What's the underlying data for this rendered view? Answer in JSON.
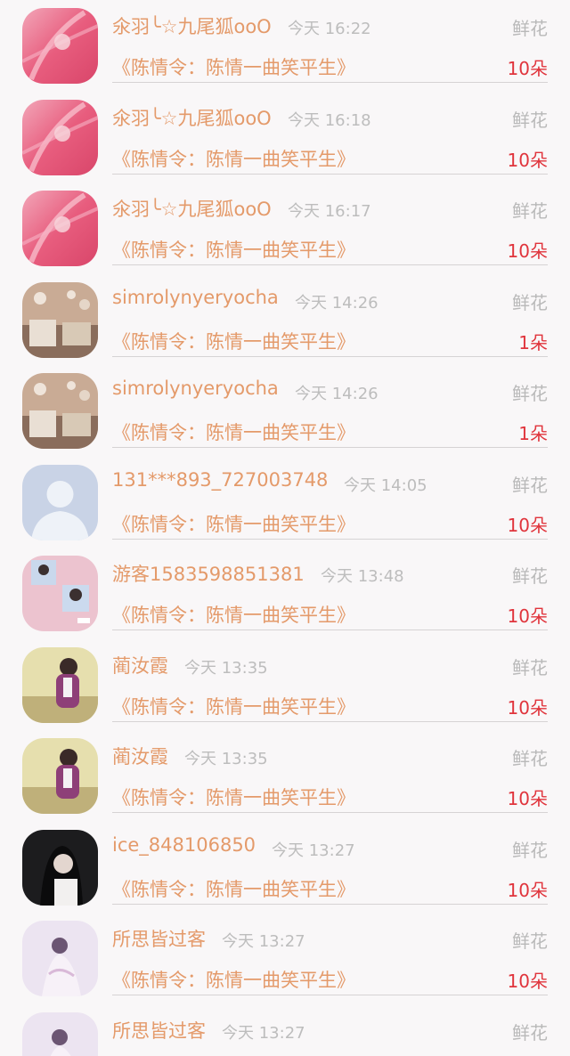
{
  "gift_list": {
    "rows": [
      {
        "user": "氽羽╰☆九尾狐ooO",
        "time": "今天 16:22",
        "gift": "鲜花",
        "work": "《陈情令：陈情一曲笑平生》",
        "count": "10朵",
        "avatar": "pink-feather-avatar"
      },
      {
        "user": "氽羽╰☆九尾狐ooO",
        "time": "今天 16:18",
        "gift": "鲜花",
        "work": "《陈情令：陈情一曲笑平生》",
        "count": "10朵",
        "avatar": "pink-feather-avatar"
      },
      {
        "user": "氽羽╰☆九尾狐ooO",
        "time": "今天 16:17",
        "gift": "鲜花",
        "work": "《陈情令：陈情一曲笑平生》",
        "count": "10朵",
        "avatar": "pink-feather-avatar"
      },
      {
        "user": "simrolynyeryocha",
        "time": "今天 14:26",
        "gift": "鲜花",
        "work": "《陈情令：陈情一曲笑平生》",
        "count": "1朵",
        "avatar": "room-photo-avatar"
      },
      {
        "user": "simrolynyeryocha",
        "time": "今天 14:26",
        "gift": "鲜花",
        "work": "《陈情令：陈情一曲笑平生》",
        "count": "1朵",
        "avatar": "room-photo-avatar"
      },
      {
        "user": "131***893_727003748",
        "time": "今天 14:05",
        "gift": "鲜花",
        "work": "《陈情令：陈情一曲笑平生》",
        "count": "10朵",
        "avatar": "default-person-avatar"
      },
      {
        "user": "游客1583598851381",
        "time": "今天 13:48",
        "gift": "鲜花",
        "work": "《陈情令：陈情一曲笑平生》",
        "count": "10朵",
        "avatar": "pink-collage-avatar"
      },
      {
        "user": "蔺汝霞",
        "time": "今天 13:35",
        "gift": "鲜花",
        "work": "《陈情令：陈情一曲笑平生》",
        "count": "10朵",
        "avatar": "girl-outdoor-avatar"
      },
      {
        "user": "蔺汝霞",
        "time": "今天 13:35",
        "gift": "鲜花",
        "work": "《陈情令：陈情一曲笑平生》",
        "count": "10朵",
        "avatar": "girl-outdoor-avatar"
      },
      {
        "user": "ice_848106850",
        "time": "今天 13:27",
        "gift": "鲜花",
        "work": "《陈情令：陈情一曲笑平生》",
        "count": "10朵",
        "avatar": "dark-portrait-avatar"
      },
      {
        "user": "所思皆过客",
        "time": "今天 13:27",
        "gift": "鲜花",
        "work": "《陈情令：陈情一曲笑平生》",
        "count": "10朵",
        "avatar": "lavender-figure-avatar"
      },
      {
        "user": "所思皆过客",
        "time": "今天 13:27",
        "gift": "鲜花",
        "work": "",
        "count": "",
        "avatar": "lavender-figure-avatar"
      }
    ]
  },
  "colors": {
    "username": "#e49a6a",
    "work_title": "#e49a6a",
    "count": "#e0343c",
    "time": "#bdbdbd",
    "gift_type": "#b9b9b9",
    "background": "#f9f7f8"
  }
}
